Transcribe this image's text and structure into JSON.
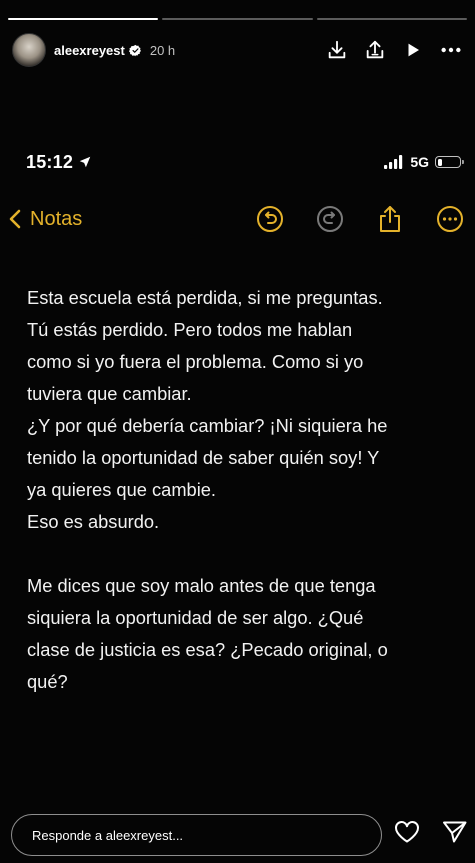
{
  "story": {
    "progress": [
      1.0,
      0.0,
      0.0
    ],
    "username": "aleexreyest",
    "time": "20 h",
    "icons": {
      "download": "download-icon",
      "share": "share-to-icon",
      "play": "play-icon",
      "more": "more-icon",
      "verified": "verified-badge-icon"
    }
  },
  "phone": {
    "clock": "15:12",
    "network": "5G",
    "battery_level": 0.2
  },
  "notes": {
    "back_label": "Notas",
    "icons": [
      "undo-icon",
      "redo-icon",
      "share-icon",
      "more-options-icon"
    ],
    "accent": "#e4b22b",
    "paragraph1": [
      "Esta escuela está perdida, si me preguntas.",
      "Tú estás perdido. Pero todos me hablan",
      "como si yo fuera el problema. Como si yo",
      "tuviera que cambiar.",
      "¿Y por qué debería cambiar? ¡Ni siquiera he",
      "tenido la oportunidad de saber quién soy! Y",
      "ya quieres que cambie.",
      "Eso es absurdo."
    ],
    "paragraph2": [
      "Me dices que soy malo antes de que tenga",
      "siquiera la oportunidad de ser algo. ¿Qué",
      "clase de justicia es esa? ¿Pecado original, o",
      "qué?"
    ]
  },
  "reply": {
    "placeholder": "Responde a aleexreyest..."
  }
}
